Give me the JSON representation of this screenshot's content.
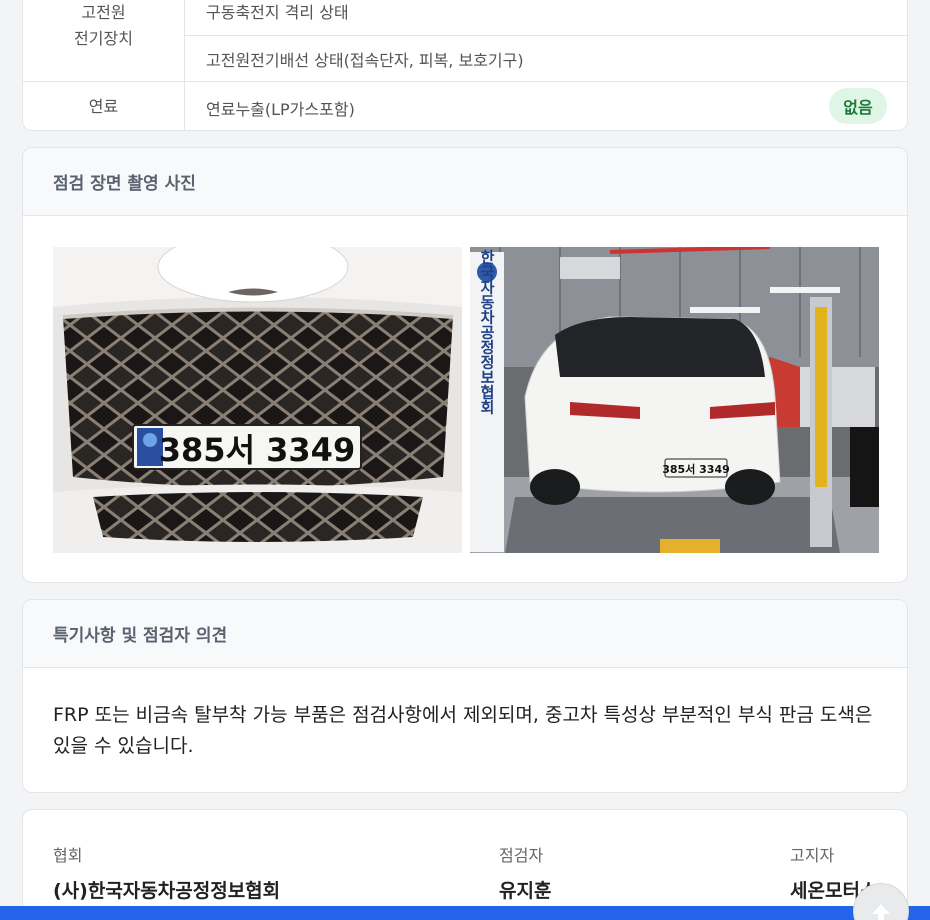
{
  "inspection_table": {
    "group_label_partial": "고전원",
    "group_label": "전기장치",
    "items": [
      {
        "label": "구동축전지 격리 상태"
      },
      {
        "label": "고전원전기배선 상태(접속단자, 피복, 보호기구)"
      }
    ],
    "fuel_row": {
      "category": "연료",
      "item": "연료누출(LP가스포함)",
      "status": "없음"
    }
  },
  "photos_section": {
    "title": "점검 장면 촬영 사진",
    "photos": [
      {
        "alt": "front grille with license plate",
        "plate_text": "385서 3349"
      },
      {
        "alt": "rear view of white SUV on inspection lift",
        "plate_text": "385서 3349",
        "banner_text": "한국자동차공정정보협회"
      }
    ]
  },
  "remarks_section": {
    "title": "특기사항 및 점검자 의견",
    "text": "FRP 또는 비금속 탈부착 가능 부품은 점검사항에서 제외되며, 중고차 특성상 부분적인 부식 판금 도색은 있을 수 있습니다."
  },
  "signature": {
    "association_label": "협회",
    "association_value": "(사)한국자동차공정정보협회",
    "inspector_label": "점검자",
    "inspector_value": "유지훈",
    "notifier_label": "고지자",
    "notifier_value": "세온모터스"
  },
  "colors": {
    "badge_bg": "#dff5e6",
    "badge_text": "#1f7a3a",
    "bottom_bar": "#2563eb"
  },
  "icons": {
    "scroll_top": "arrow-up-icon"
  }
}
